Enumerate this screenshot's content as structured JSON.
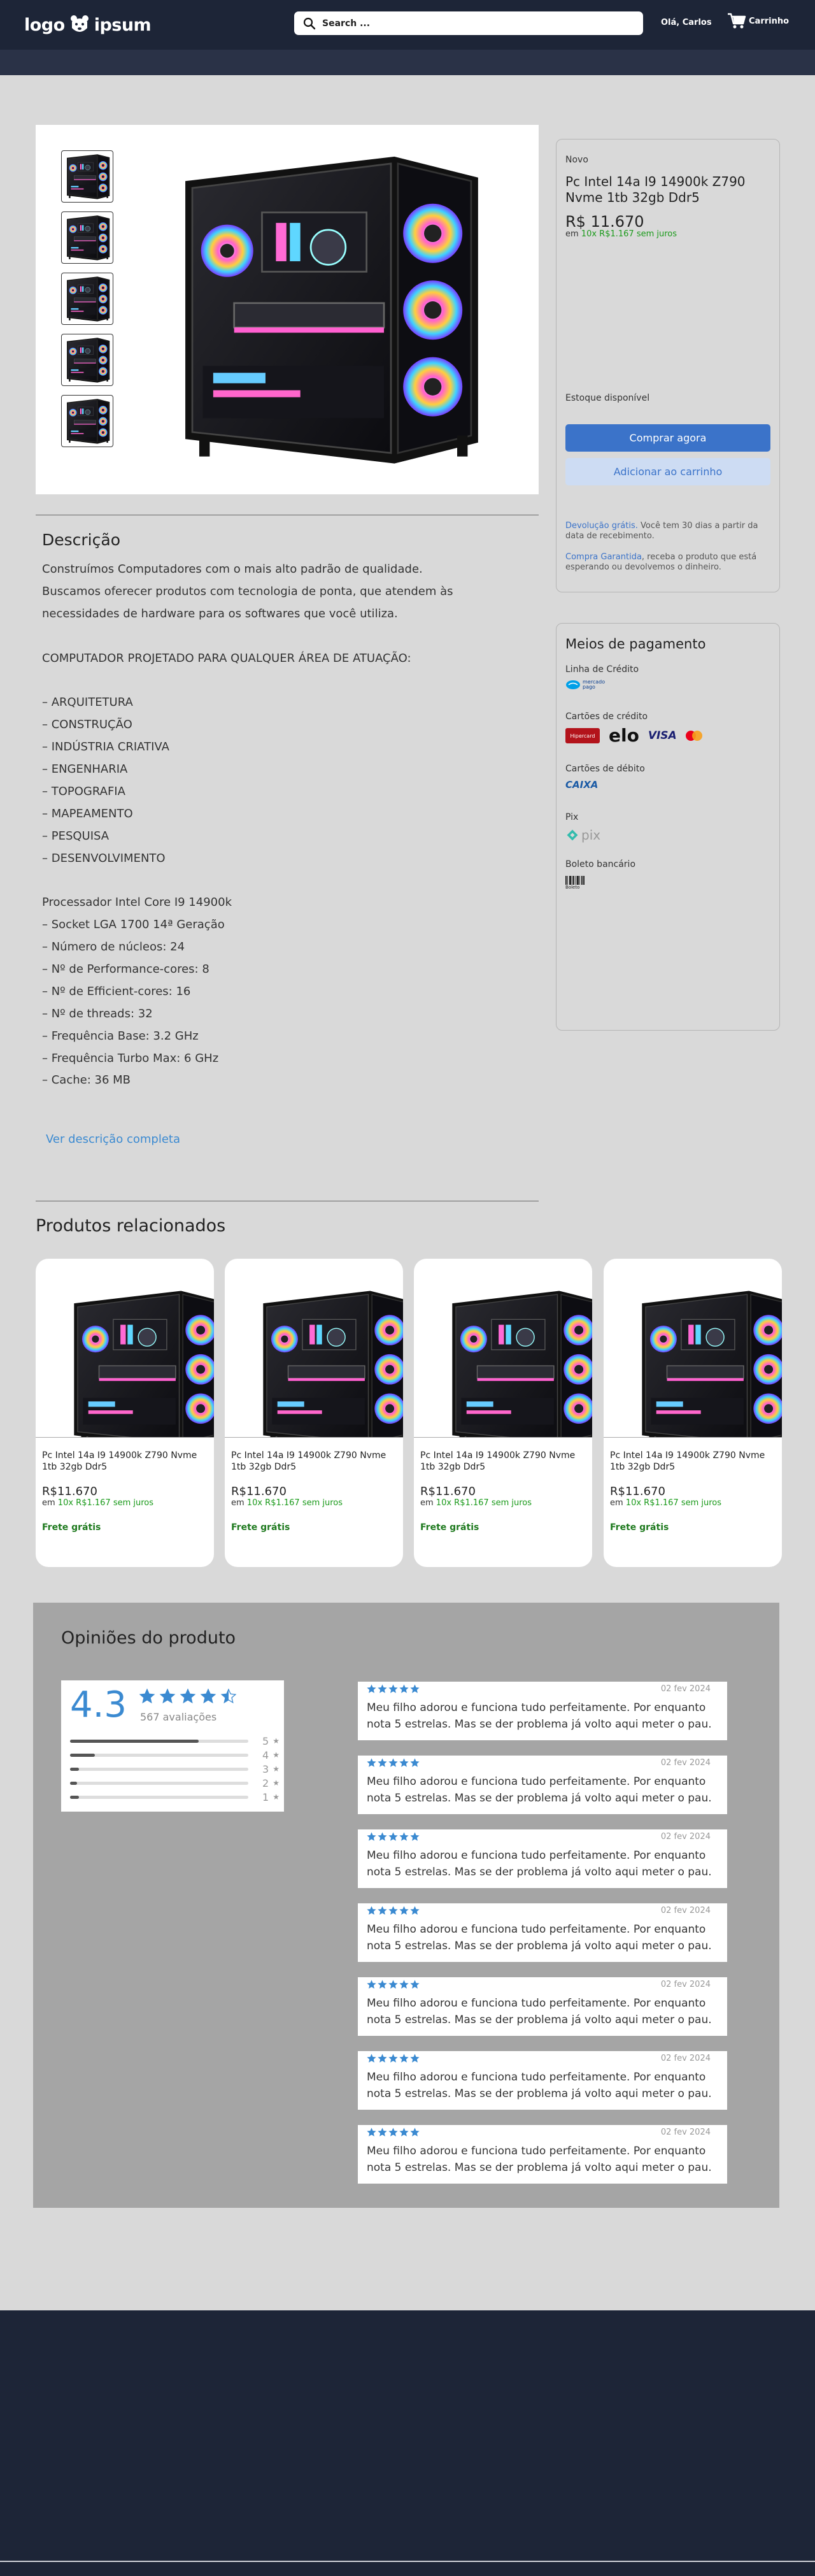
{
  "header": {
    "logo_text_left": "logo",
    "logo_text_right": "ipsum",
    "search_placeholder": "Search ...",
    "greeting": "Olá, Carlos",
    "cart_label": "Carrinho"
  },
  "product": {
    "condition": "Novo",
    "title": "Pc Intel 14a I9 14900k Z790 Nvme 1tb 32gb Ddr5",
    "price": "R$ 11.670",
    "installments_prefix": "em ",
    "installments": "10x R$1.167 sem juros",
    "stock": "Estoque disponível",
    "buy_button": "Comprar agora",
    "cart_button": "Adicionar ao carrinho",
    "returns_link": "Devolução grátis.",
    "returns_text": " Você tem 30 dias a partir da data de recebimento.",
    "warranty_link": "Compra Garantida",
    "warranty_text": ", receba o produto que está esperando ou devolvemos o dinheiro."
  },
  "payment": {
    "title": "Meios de pagamento",
    "credit_line_label": "Linha de Crédito",
    "credit_cards_label": "Cartões de crédito",
    "debit_cards_label": "Cartões de  débito",
    "pix_label": "Pix",
    "boleto_label": "Boleto bancário",
    "mercado_pago": "mercado pago",
    "hipercard": "Hipercard",
    "elo": "elo",
    "visa": "VISA",
    "caixa": "CAIXA",
    "pix": "pix",
    "boleto": "Boleto"
  },
  "description": {
    "title": "Descrição",
    "lines": [
      "Construímos Computadores com o mais alto padrão de qualidade.",
      "Buscamos oferecer produtos com tecnologia de ponta, que atendem às",
      "necessidades de hardware para os softwares que você utiliza.",
      "",
      "COMPUTADOR PROJETADO PARA QUALQUER ÁREA DE ATUAÇÃO:",
      "",
      "– ARQUITETURA",
      "– CONSTRUÇÃO",
      "– INDÚSTRIA CRIATIVA",
      "– ENGENHARIA",
      "– TOPOGRAFIA",
      "– MAPEAMENTO",
      "– PESQUISA",
      "– DESENVOLVIMENTO",
      "",
      "Processador Intel Core I9 14900k",
      "– Socket LGA 1700 14ª Geração",
      "– Número de núcleos: 24",
      "– Nº de Performance-cores: 8",
      "– Nº de Efficient-cores: 16",
      "– Nº de threads: 32",
      "– Frequência Base: 3.2 GHz",
      "– Frequência Turbo Max: 6 GHz",
      "– Cache: 36 MB"
    ],
    "see_more": "Ver descrição completa"
  },
  "related": {
    "title": "Produtos relacionados",
    "items": [
      {
        "title": "Pc Intel 14a I9 14900k Z790 Nvme 1tb 32gb Ddr5",
        "price": "R$11.670",
        "inst_prefix": "em ",
        "inst": "10x R$1.167 sem juros",
        "shipping": "Frete grátis"
      },
      {
        "title": "Pc Intel 14a I9 14900k Z790 Nvme 1tb 32gb Ddr5",
        "price": "R$11.670",
        "inst_prefix": "em ",
        "inst": "10x R$1.167 sem juros",
        "shipping": "Frete grátis"
      },
      {
        "title": "Pc Intel 14a I9 14900k Z790 Nvme 1tb 32gb Ddr5",
        "price": "R$11.670",
        "inst_prefix": "em ",
        "inst": "10x R$1.167 sem juros",
        "shipping": "Frete grátis"
      },
      {
        "title": "Pc Intel 14a I9 14900k Z790 Nvme 1tb 32gb Ddr5",
        "price": "R$11.670",
        "inst_prefix": "em ",
        "inst": "10x R$1.167 sem juros",
        "shipping": "Frete grátis"
      }
    ]
  },
  "reviews": {
    "title": "Opiniões do produto",
    "average": "4.3",
    "count": "567 avaliações",
    "distribution": [
      {
        "stars": "5",
        "fraction": 0.72
      },
      {
        "stars": "4",
        "fraction": 0.14
      },
      {
        "stars": "3",
        "fraction": 0.05
      },
      {
        "stars": "2",
        "fraction": 0.04
      },
      {
        "stars": "1",
        "fraction": 0.05
      }
    ],
    "items": [
      {
        "date": "02 fev 2024",
        "text": "Meu filho adorou e funciona tudo perfeitamente. Por enquanto nota 5 estrelas. Mas se der problema já volto aqui meter o pau."
      },
      {
        "date": "02 fev 2024",
        "text": "Meu filho adorou e funciona tudo perfeitamente. Por enquanto nota 5 estrelas. Mas se der problema já volto aqui meter o pau."
      },
      {
        "date": "02 fev 2024",
        "text": "Meu filho adorou e funciona tudo perfeitamente. Por enquanto nota 5 estrelas. Mas se der problema já volto aqui meter o pau."
      },
      {
        "date": "02 fev 2024",
        "text": "Meu filho adorou e funciona tudo perfeitamente. Por enquanto nota 5 estrelas. Mas se der problema já volto aqui meter o pau."
      },
      {
        "date": "02 fev 2024",
        "text": "Meu filho adorou e funciona tudo perfeitamente. Por enquanto nota 5 estrelas. Mas se der problema já volto aqui meter o pau."
      },
      {
        "date": "02 fev 2024",
        "text": "Meu filho adorou e funciona tudo perfeitamente. Por enquanto nota 5 estrelas. Mas se der problema já volto aqui meter o pau."
      },
      {
        "date": "02 fev 2024",
        "text": "Meu filho adorou e funciona tudo perfeitamente. Por enquanto nota 5 estrelas. Mas se der problema já volto aqui meter o pau."
      }
    ]
  },
  "colors": {
    "header_bg": "#1d2537",
    "accent_blue": "#3b73c9",
    "price_green": "#1a9a1a",
    "star_blue": "#3b8ad1"
  }
}
